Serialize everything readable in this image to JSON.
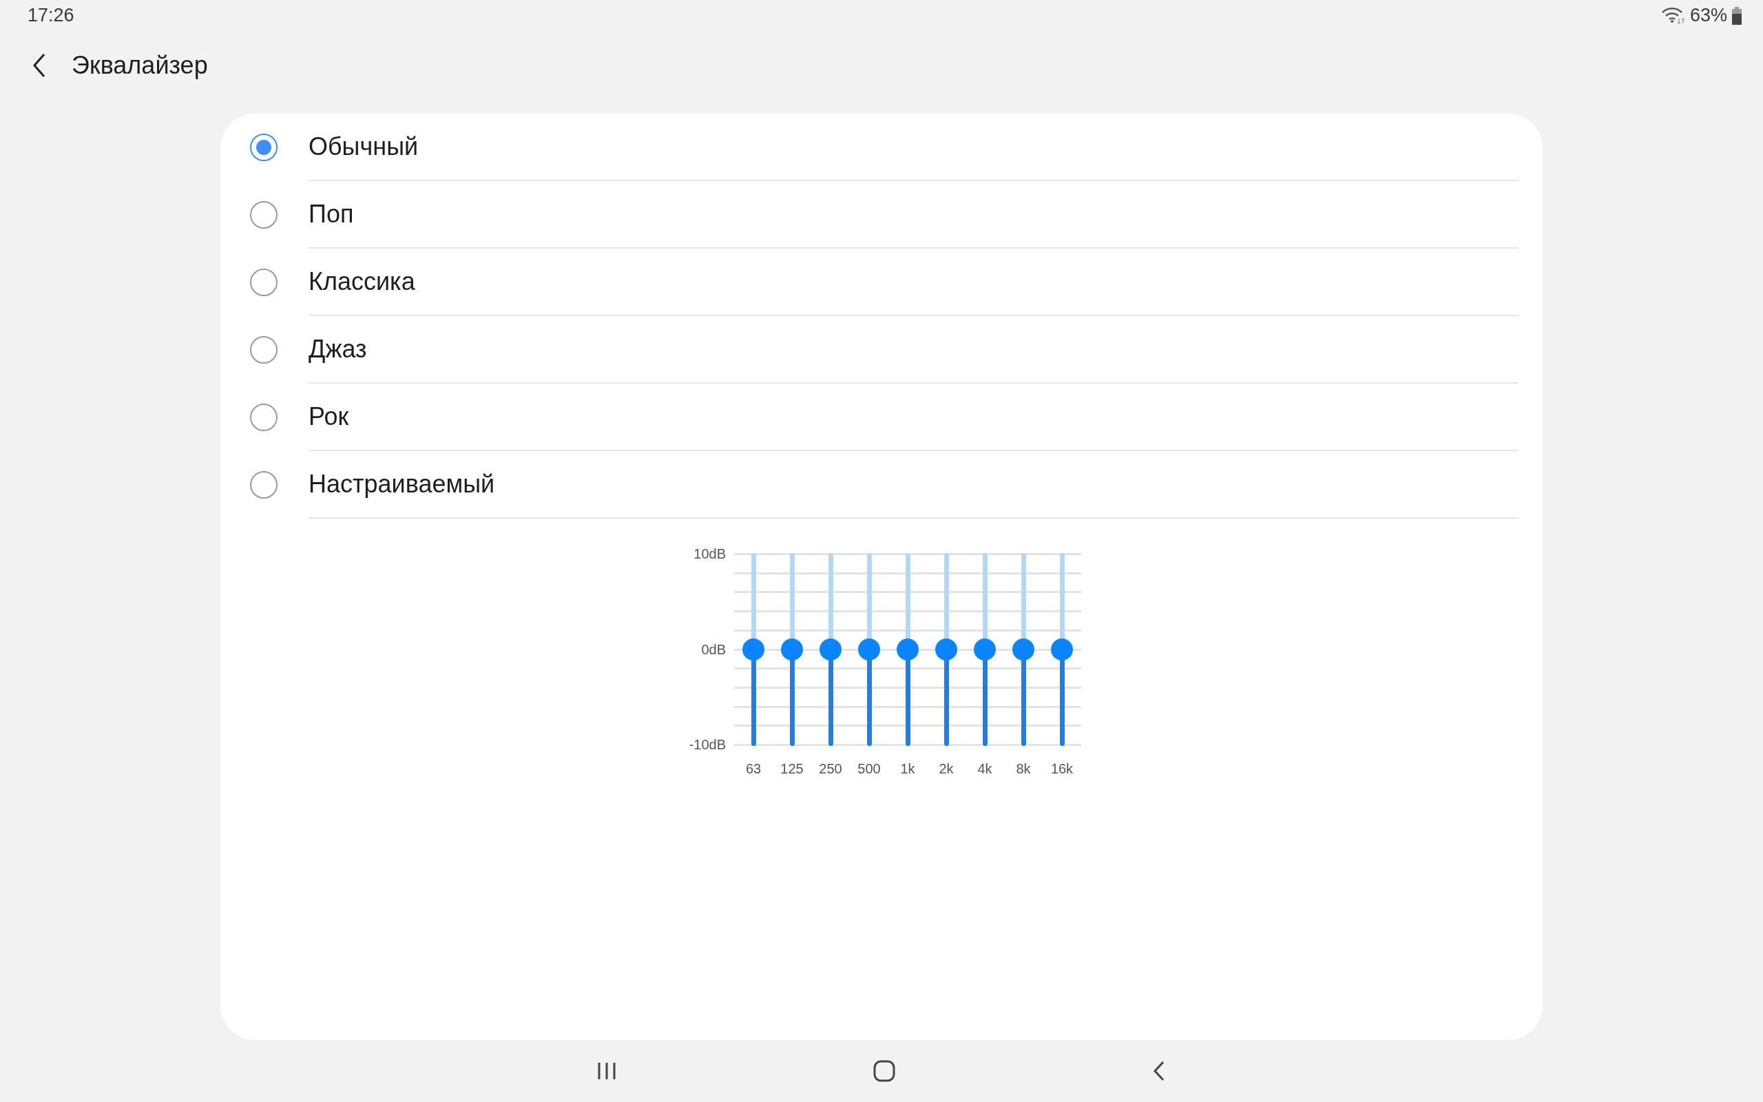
{
  "status_bar": {
    "time": "17:26",
    "battery": "63%"
  },
  "header": {
    "title": "Эквалайзер"
  },
  "presets": [
    {
      "label": "Обычный",
      "selected": true
    },
    {
      "label": "Поп",
      "selected": false
    },
    {
      "label": "Классика",
      "selected": false
    },
    {
      "label": "Джаз",
      "selected": false
    },
    {
      "label": "Рок",
      "selected": false
    },
    {
      "label": "Настраиваемый",
      "selected": false
    }
  ],
  "equalizer": {
    "scale": [
      "10dB",
      "0dB",
      "-10dB"
    ],
    "bands": [
      {
        "label": "63",
        "level": 0.5
      },
      {
        "label": "125",
        "level": 0.5
      },
      {
        "label": "250",
        "level": 0.5
      },
      {
        "label": "500",
        "level": 0.5
      },
      {
        "label": "1k",
        "level": 0.5
      },
      {
        "label": "2k",
        "level": 0.5
      },
      {
        "label": "4k",
        "level": 0.5
      },
      {
        "label": "8k",
        "level": 0.5
      },
      {
        "label": "16k",
        "level": 0.5
      }
    ]
  }
}
